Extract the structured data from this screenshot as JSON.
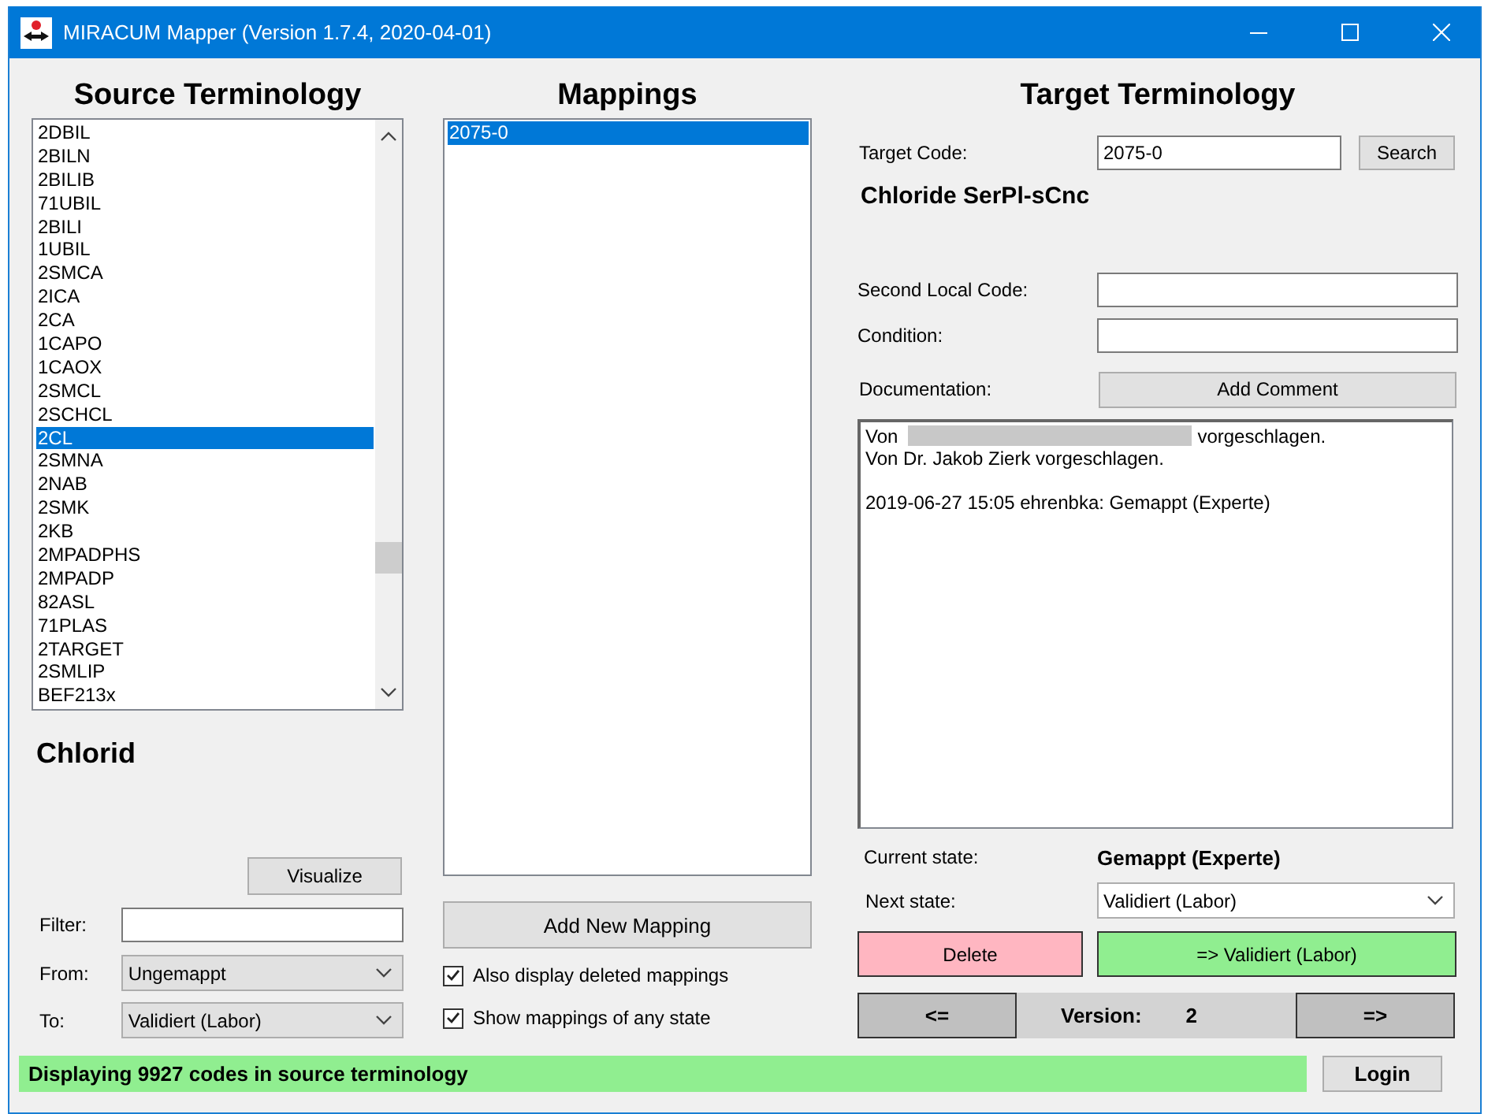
{
  "window": {
    "title": "MIRACUM Mapper (Version 1.7.4, 2020-04-01)"
  },
  "source": {
    "heading": "Source Terminology",
    "items": [
      {
        "label": "2DBIL",
        "selected": false
      },
      {
        "label": "2BILN",
        "selected": false
      },
      {
        "label": "2BILIB",
        "selected": false
      },
      {
        "label": "71UBIL",
        "selected": false
      },
      {
        "label": "2BILI",
        "selected": false
      },
      {
        "label": "1UBIL",
        "selected": false
      },
      {
        "label": "2SMCA",
        "selected": false
      },
      {
        "label": "2ICA",
        "selected": false
      },
      {
        "label": "2CA",
        "selected": false
      },
      {
        "label": "1CAPO",
        "selected": false
      },
      {
        "label": "1CAOX",
        "selected": false
      },
      {
        "label": "2SMCL",
        "selected": false
      },
      {
        "label": "2SCHCL",
        "selected": false
      },
      {
        "label": "2CL",
        "selected": true
      },
      {
        "label": "2SMNA",
        "selected": false
      },
      {
        "label": "2NAB",
        "selected": false
      },
      {
        "label": "2SMK",
        "selected": false
      },
      {
        "label": "2KB",
        "selected": false
      },
      {
        "label": "2MPADPHS",
        "selected": false
      },
      {
        "label": "2MPADP",
        "selected": false
      },
      {
        "label": "82ASL",
        "selected": false
      },
      {
        "label": "71PLAS",
        "selected": false
      },
      {
        "label": "2TARGET",
        "selected": false
      },
      {
        "label": "2SMLIP",
        "selected": false
      },
      {
        "label": "BEF213x",
        "selected": false
      }
    ],
    "name": "Chlorid",
    "visualize_button": "Visualize",
    "filter": {
      "label": "Filter:"
    },
    "from": {
      "label": "From:",
      "value": "Ungemappt"
    },
    "to": {
      "label": "To:",
      "value": "Validiert (Labor)"
    }
  },
  "mappings": {
    "heading": "Mappings",
    "items": [
      {
        "label": "2075-0",
        "selected": true
      }
    ],
    "add_button": "Add New Mapping",
    "options": [
      {
        "label": "Also display deleted mappings",
        "checked": true
      },
      {
        "label": "Show mappings of any state",
        "checked": true
      }
    ]
  },
  "target": {
    "heading": "Target Terminology",
    "target_code": {
      "label": "Target Code:",
      "value": "2075-0"
    },
    "search_button": "Search",
    "name": "Chloride SerPl-sCnc",
    "second_local_code": {
      "label": "Second Local Code:"
    },
    "condition": {
      "label": "Condition:"
    },
    "documentation": {
      "label": "Documentation:",
      "button": "Add Comment",
      "lines": [
        {
          "kind": "redacted",
          "before": "Von",
          "after": "vorgeschlagen."
        },
        {
          "kind": "text",
          "text": "Von Dr. Jakob Zierk vorgeschlagen."
        },
        {
          "kind": "blank"
        },
        {
          "kind": "text",
          "text": "2019-06-27 15:05 ehrenbka: Gemappt (Experte)"
        }
      ]
    },
    "current_state": {
      "label": "Current state:",
      "value": "Gemappt (Experte)"
    },
    "next_state": {
      "label": "Next state:",
      "value": "Validiert (Labor)"
    },
    "delete_button": "Delete",
    "advance_button": "=> Validiert (Labor)",
    "version": {
      "previous_button": "<=",
      "label": "Version:",
      "value": "2",
      "next_button": "=>"
    }
  },
  "status_bar": {
    "text": "Displaying 9927 codes in source terminology",
    "login_button": "Login"
  }
}
